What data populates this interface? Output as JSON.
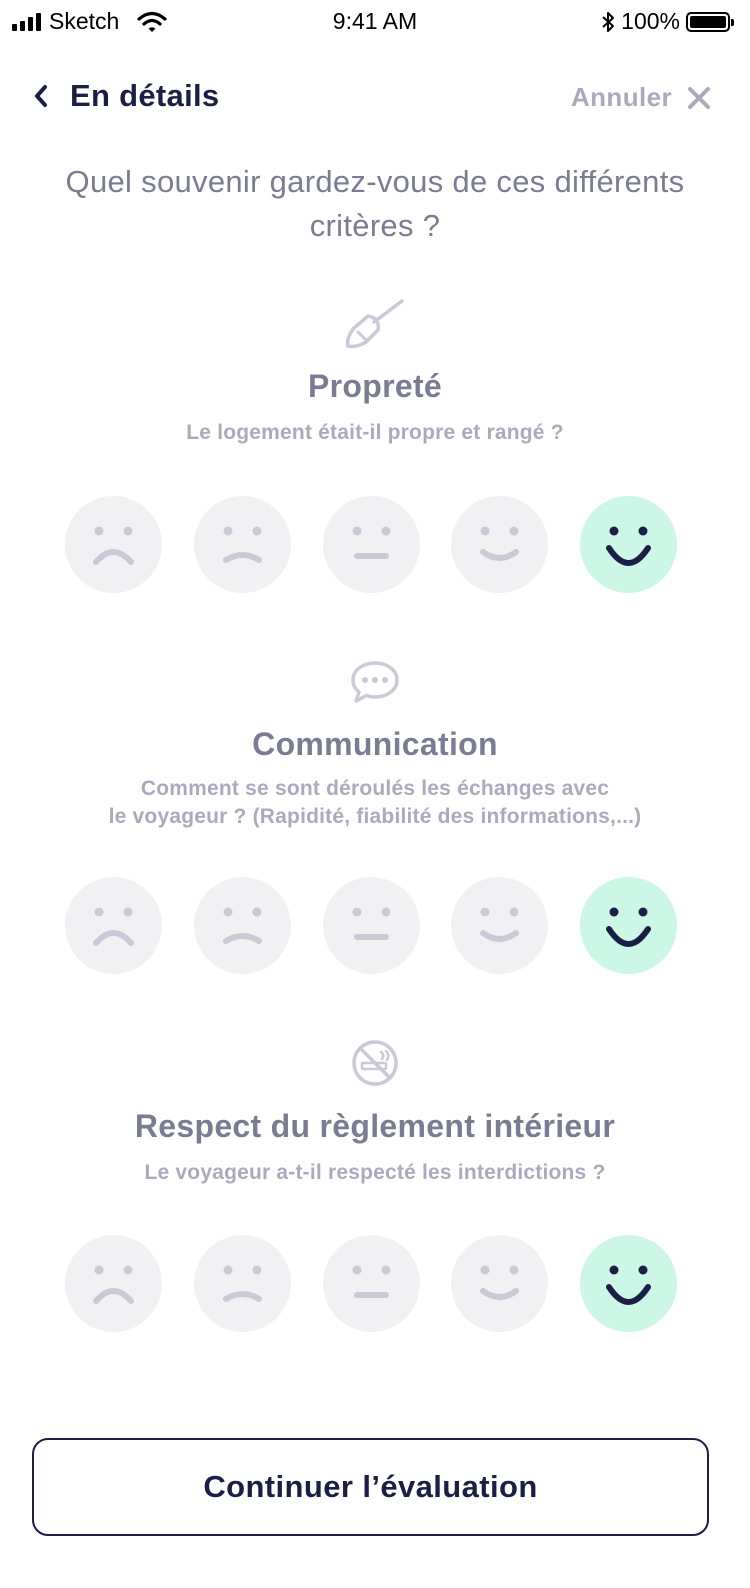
{
  "status_bar": {
    "carrier": "Sketch",
    "time": "9:41 AM",
    "battery": "100%"
  },
  "header": {
    "title": "En détails",
    "cancel_label": "Annuler"
  },
  "question": "Quel souvenir gardez-vous de ces différents critères ?",
  "criteria": [
    {
      "icon": "broom-icon",
      "title": "Propreté",
      "subtitle_lines": [
        "Le logement était-il propre et rangé ?"
      ],
      "selected_rating": 5,
      "rating_max": 5
    },
    {
      "icon": "chat-bubble-icon",
      "title": "Communication",
      "subtitle_lines": [
        "Comment se sont déroulés les échanges avec",
        "le voyageur ? (Rapidité, fiabilité des informations,...)"
      ],
      "selected_rating": 5,
      "rating_max": 5
    },
    {
      "icon": "no-smoking-icon",
      "title": "Respect du règlement intérieur",
      "subtitle_lines": [
        "Le voyageur a-t-il respecté les interdictions ?"
      ],
      "selected_rating": 5,
      "rating_max": 5
    }
  ],
  "continue_label": "Continuer l’évaluation",
  "colors": {
    "primary": "#1b1e45",
    "muted": "#7a7c92",
    "light": "#a9abbd",
    "face_bg": "#f1f1f4",
    "face_selected_bg": "#ccf6e5"
  }
}
